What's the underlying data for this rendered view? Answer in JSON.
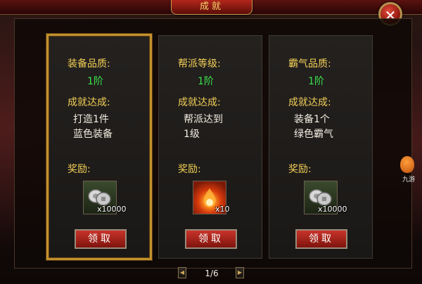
{
  "window": {
    "title": "成就",
    "close_glyph": "✕"
  },
  "panels": [
    {
      "category_label": "装备品质:",
      "level": "1阶",
      "achievement_label": "成就达成:",
      "achievement_lines": [
        "打造1件",
        "蓝色装备"
      ],
      "reward_label": "奖励:",
      "reward_icon": "silver-coin-icon",
      "reward_qty": "x10000",
      "claim_label": "领取",
      "selected": true
    },
    {
      "category_label": "帮派等级:",
      "level": "1阶",
      "achievement_label": "成就达成:",
      "achievement_lines": [
        "帮派达到",
        "1级"
      ],
      "reward_label": "奖励:",
      "reward_icon": "fire-orb-icon",
      "reward_qty": "x10",
      "claim_label": "领取",
      "selected": false
    },
    {
      "category_label": "霸气品质:",
      "level": "1阶",
      "achievement_label": "成就达成:",
      "achievement_lines": [
        "装备1个",
        "绿色霸气"
      ],
      "reward_label": "奖励:",
      "reward_icon": "silver-coin-icon",
      "reward_qty": "x10000",
      "claim_label": "领取",
      "selected": false
    }
  ],
  "pager": {
    "indicator": "1/6",
    "prev_glyph": "◀",
    "next_glyph": "▶"
  },
  "side_widget": {
    "label": "九游",
    "icon": "mascot-icon"
  },
  "colors": {
    "label_yellow": "#f2cf57",
    "level_green": "#3be04c",
    "claim_red": "#c8342a",
    "selected_border": "#c4902d"
  }
}
